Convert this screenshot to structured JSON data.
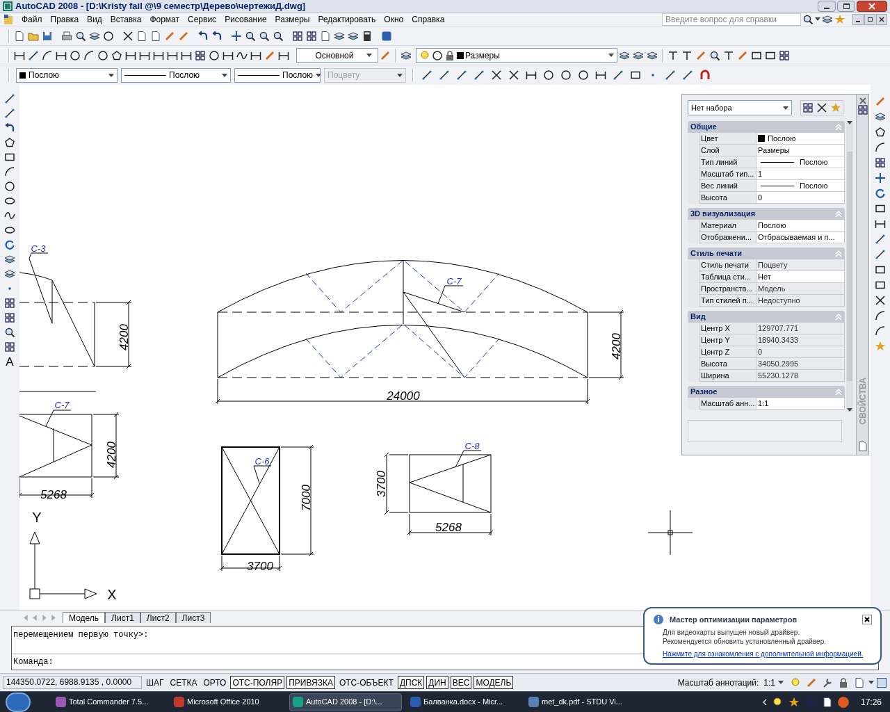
{
  "window": {
    "title": "AutoCAD 2008 - [D:\\Kristy fail @\\9 семестр\\Дерево\\чертежиД.dwg]"
  },
  "menu": [
    "Файл",
    "Правка",
    "Вид",
    "Вставка",
    "Формат",
    "Сервис",
    "Рисование",
    "Размеры",
    "Редактировать",
    "Окно",
    "Справка"
  ],
  "help_search": {
    "placeholder": "Введите вопрос для справки"
  },
  "dim_style": "Основной",
  "layer": {
    "name": "Размеры",
    "color": "#000000"
  },
  "object_properties": [
    {
      "kind": "color",
      "value": "Послою",
      "color": "#000000",
      "disabled": false
    },
    {
      "kind": "line",
      "value": "Послою",
      "disabled": false
    },
    {
      "kind": "line",
      "value": "Послою",
      "disabled": false
    },
    {
      "kind": "plain",
      "value": "Поцвету",
      "disabled": true
    }
  ],
  "left_toolbar_text": "A",
  "drawing": {
    "labels": [
      "C-3",
      "4200",
      "C-7",
      "4200",
      "24000",
      "C-7",
      "4200",
      "5268",
      "C-6",
      "7000",
      "3700",
      "C-8",
      "3700",
      "5268",
      "Y",
      "X"
    ]
  },
  "properties": {
    "selection": "Нет набора",
    "title": "СВОЙСТВА",
    "sections": [
      {
        "title": "Общие",
        "rows": [
          {
            "name": "Цвет",
            "value": "Послою",
            "kind": "color",
            "color": "#000000",
            "disabled": false
          },
          {
            "name": "Слой",
            "value": "Размеры",
            "kind": "text",
            "disabled": false
          },
          {
            "name": "Тип линий",
            "value": "Послою",
            "kind": "line",
            "disabled": false
          },
          {
            "name": "Масштаб тип...",
            "value": "1",
            "kind": "text",
            "disabled": false
          },
          {
            "name": "Вес линий",
            "value": "Послою",
            "kind": "line",
            "disabled": false
          },
          {
            "name": "Высота",
            "value": "0",
            "kind": "text",
            "disabled": false
          }
        ]
      },
      {
        "title": "3D визуализация",
        "rows": [
          {
            "name": "Материал",
            "value": "Послою",
            "kind": "text",
            "disabled": false
          },
          {
            "name": "Отображени...",
            "value": "Отбрасываемая и п...",
            "kind": "text",
            "disabled": false
          }
        ]
      },
      {
        "title": "Стиль печати",
        "rows": [
          {
            "name": "Стиль печати",
            "value": "Поцвету",
            "kind": "text",
            "disabled": true
          },
          {
            "name": "Таблица сти...",
            "value": "Нет",
            "kind": "text",
            "disabled": false
          },
          {
            "name": "Пространств...",
            "value": "Модель",
            "kind": "text",
            "disabled": true
          },
          {
            "name": "Тип стилей п...",
            "value": "Недоступно",
            "kind": "text",
            "disabled": true
          }
        ]
      },
      {
        "title": "Вид",
        "rows": [
          {
            "name": "Центр X",
            "value": "129707.771",
            "kind": "text",
            "disabled": true
          },
          {
            "name": "Центр Y",
            "value": "18940.3433",
            "kind": "text",
            "disabled": true
          },
          {
            "name": "Центр Z",
            "value": "0",
            "kind": "text",
            "disabled": true
          },
          {
            "name": "Высота",
            "value": "34050.2995",
            "kind": "text",
            "disabled": true
          },
          {
            "name": "Ширина",
            "value": "55230.1278",
            "kind": "text",
            "disabled": true
          }
        ]
      },
      {
        "title": "Разное",
        "rows": [
          {
            "name": "Масштаб анн...",
            "value": "1:1",
            "kind": "text",
            "disabled": false
          }
        ]
      }
    ]
  },
  "layout_tabs": [
    {
      "label": "Модель",
      "selected": true
    },
    {
      "label": "Лист1",
      "selected": false
    },
    {
      "label": "Лист2",
      "selected": false
    },
    {
      "label": "Лист3",
      "selected": false
    }
  ],
  "command": {
    "history": "перемещением первую точку>:",
    "prompt": "Команда:"
  },
  "status_bar": {
    "coordinates": "144350.0722, 6988.9135 , 0.0000",
    "toggles": [
      {
        "label": "ШАГ",
        "on": false
      },
      {
        "label": "СЕТКА",
        "on": false
      },
      {
        "label": "ОРТО",
        "on": false
      },
      {
        "label": "ОТС-ПОЛЯР",
        "on": true
      },
      {
        "label": "ПРИВЯЗКА",
        "on": true
      },
      {
        "label": "ОТС-ОБЪЕКТ",
        "on": false
      },
      {
        "label": "ДПСК",
        "on": true
      },
      {
        "label": "ДИН",
        "on": true
      },
      {
        "label": "ВЕС",
        "on": true
      },
      {
        "label": "МОДЕЛЬ",
        "on": true
      }
    ],
    "annotation_scale_label": "Масштаб аннотаций:",
    "annotation_scale": "1:1"
  },
  "notification": {
    "title": "Мастер оптимизации параметров",
    "lines": [
      "Для видеокарты выпущен новый драйвер.",
      "Рекомендуется обновить установленный драйвер."
    ],
    "link": "Нажмите для ознакомления с дополнительной информацией."
  },
  "taskbar": {
    "items": [
      {
        "label": "Total Commander 7.5...",
        "selected": false,
        "color": "#9b59b6"
      },
      {
        "label": "Microsoft Office 2010",
        "selected": false,
        "color": "#c0392b"
      },
      {
        "label": "AutoCAD 2008 - [D:\\...",
        "selected": true,
        "color": "#16a085"
      },
      {
        "label": "Балванка.docx - Micr...",
        "selected": false,
        "color": "#2a5db0"
      },
      {
        "label": "met_dk.pdf - STDU Vi...",
        "selected": false,
        "color": "#5b7fb5"
      }
    ],
    "clock": "17:26"
  }
}
